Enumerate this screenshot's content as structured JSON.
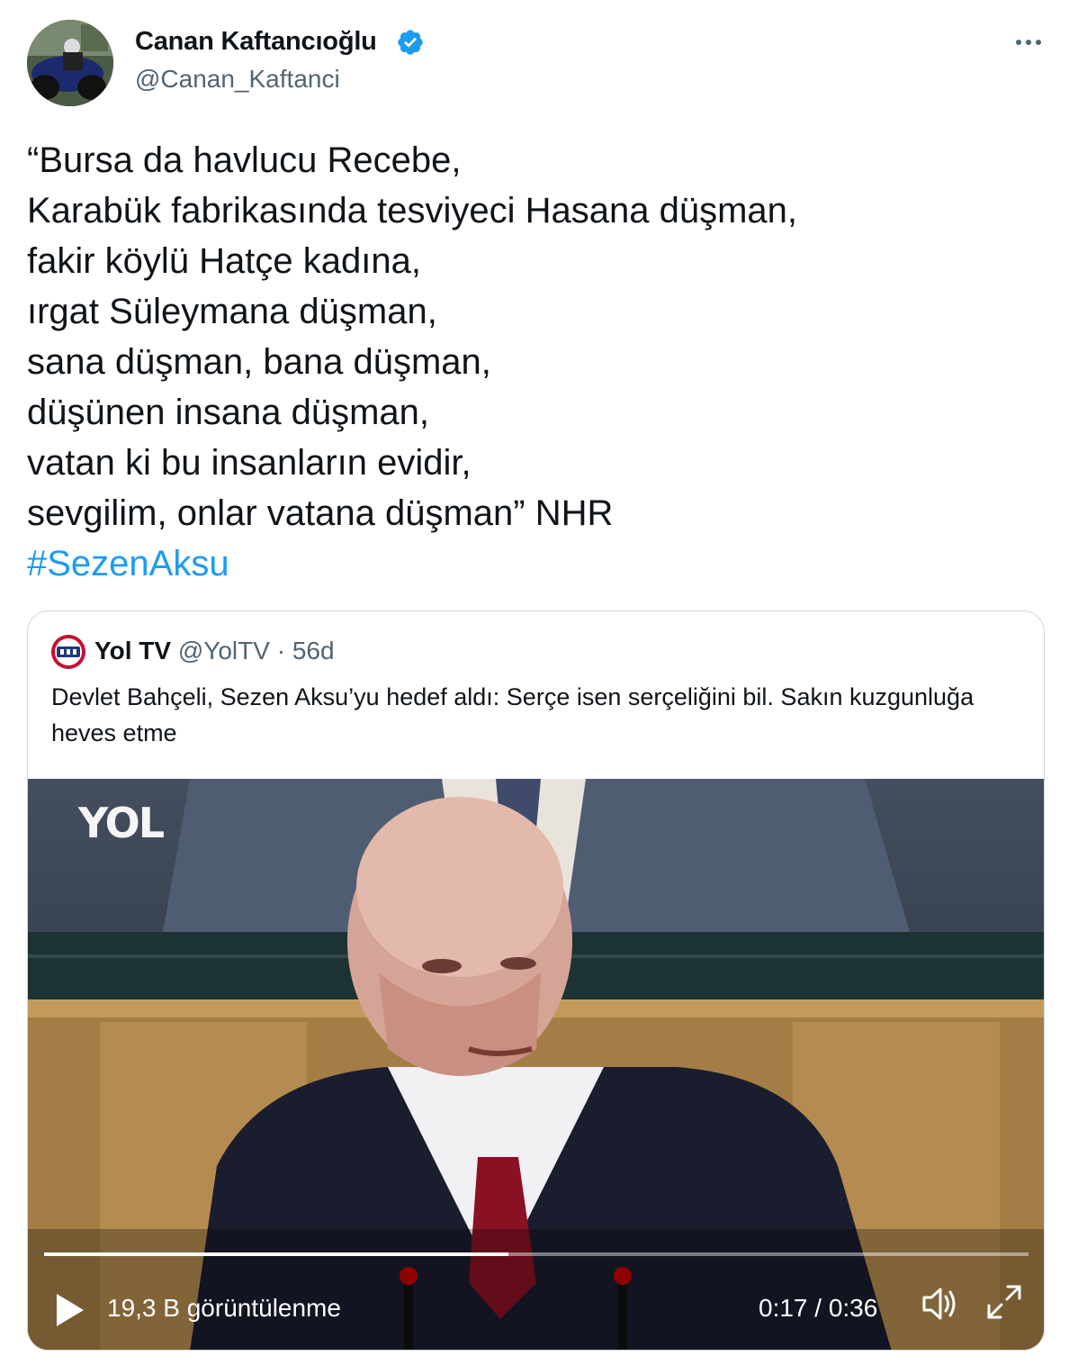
{
  "author": {
    "name": "Canan Kaftancıoğlu",
    "handle": "@Canan_Kaftanci",
    "verified": true,
    "verified_icon": "verified-badge-icon"
  },
  "more_icon": "more-options-icon",
  "tweet": {
    "lines": [
      "“Bursa da havlucu Recebe,",
      "Karabük fabrikasında tesviyeci Hasana düşman,",
      "fakir köylü Hatçe kadına,",
      "ırgat Süleymana düşman,",
      "sana düşman, bana düşman,",
      "düşünen insana düşman,",
      "vatan ki bu insanların evidir,",
      "sevgilim, onlar vatana düşman” NHR"
    ],
    "hashtag": "#SezenAksu"
  },
  "quoted": {
    "name": "Yol TV",
    "handle": "@YolTV",
    "separator": "·",
    "time": "56d",
    "text": "Devlet Bahçeli, Sezen Aksu’yu hedef aldı: Serçe isen serçeliğini bil. Sakın kuzgunluğa heves etme"
  },
  "video": {
    "watermark": "YOL",
    "views": "19,3 B görüntülenme",
    "timecode": "0:17 / 0:36",
    "progress": 0.472,
    "icons": [
      "play-icon",
      "volume-icon",
      "fullscreen-icon"
    ]
  },
  "colors": {
    "text": "#0f1419",
    "secondary": "#536471",
    "link": "#1d9bf0",
    "border": "#cfd9de"
  }
}
